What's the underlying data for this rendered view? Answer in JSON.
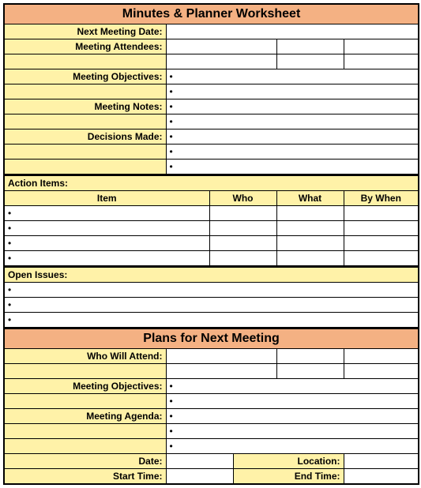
{
  "title1": "Minutes & Planner Worksheet",
  "labels": {
    "nextMeetingDate": "Next Meeting Date:",
    "meetingAttendees": "Meeting Attendees:",
    "meetingObjectives": "Meeting Objectives:",
    "meetingNotes": "Meeting Notes:",
    "decisionsMade": "Decisions Made:",
    "actionItems": "Action Items:",
    "openIssues": "Open Issues:",
    "whoWillAttend": "Who Will Attend:",
    "meetingAgenda": "Meeting Agenda:",
    "date": "Date:",
    "location": "Location:",
    "startTime": "Start Time:",
    "endTime": "End Time:"
  },
  "columns": {
    "item": "Item",
    "who": "Who",
    "what": "What",
    "byWhen": "By When"
  },
  "title2": "Plans for Next Meeting",
  "bullet": "•",
  "values": {
    "nextMeetingDate": "",
    "attendees": [
      "",
      "",
      "",
      "",
      "",
      ""
    ],
    "objectives": [
      "",
      ""
    ],
    "notes": [
      "",
      ""
    ],
    "decisions": [
      "",
      "",
      ""
    ],
    "actionRows": [
      {
        "item": "",
        "who": "",
        "what": "",
        "byWhen": ""
      },
      {
        "item": "",
        "who": "",
        "what": "",
        "byWhen": ""
      },
      {
        "item": "",
        "who": "",
        "what": "",
        "byWhen": ""
      },
      {
        "item": "",
        "who": "",
        "what": "",
        "byWhen": ""
      }
    ],
    "openIssues": [
      "",
      "",
      ""
    ],
    "nextAttendees": [
      "",
      "",
      "",
      "",
      "",
      ""
    ],
    "nextObjectives": [
      "",
      ""
    ],
    "agenda": [
      "",
      "",
      ""
    ],
    "date": "",
    "location": "",
    "startTime": "",
    "endTime": ""
  }
}
